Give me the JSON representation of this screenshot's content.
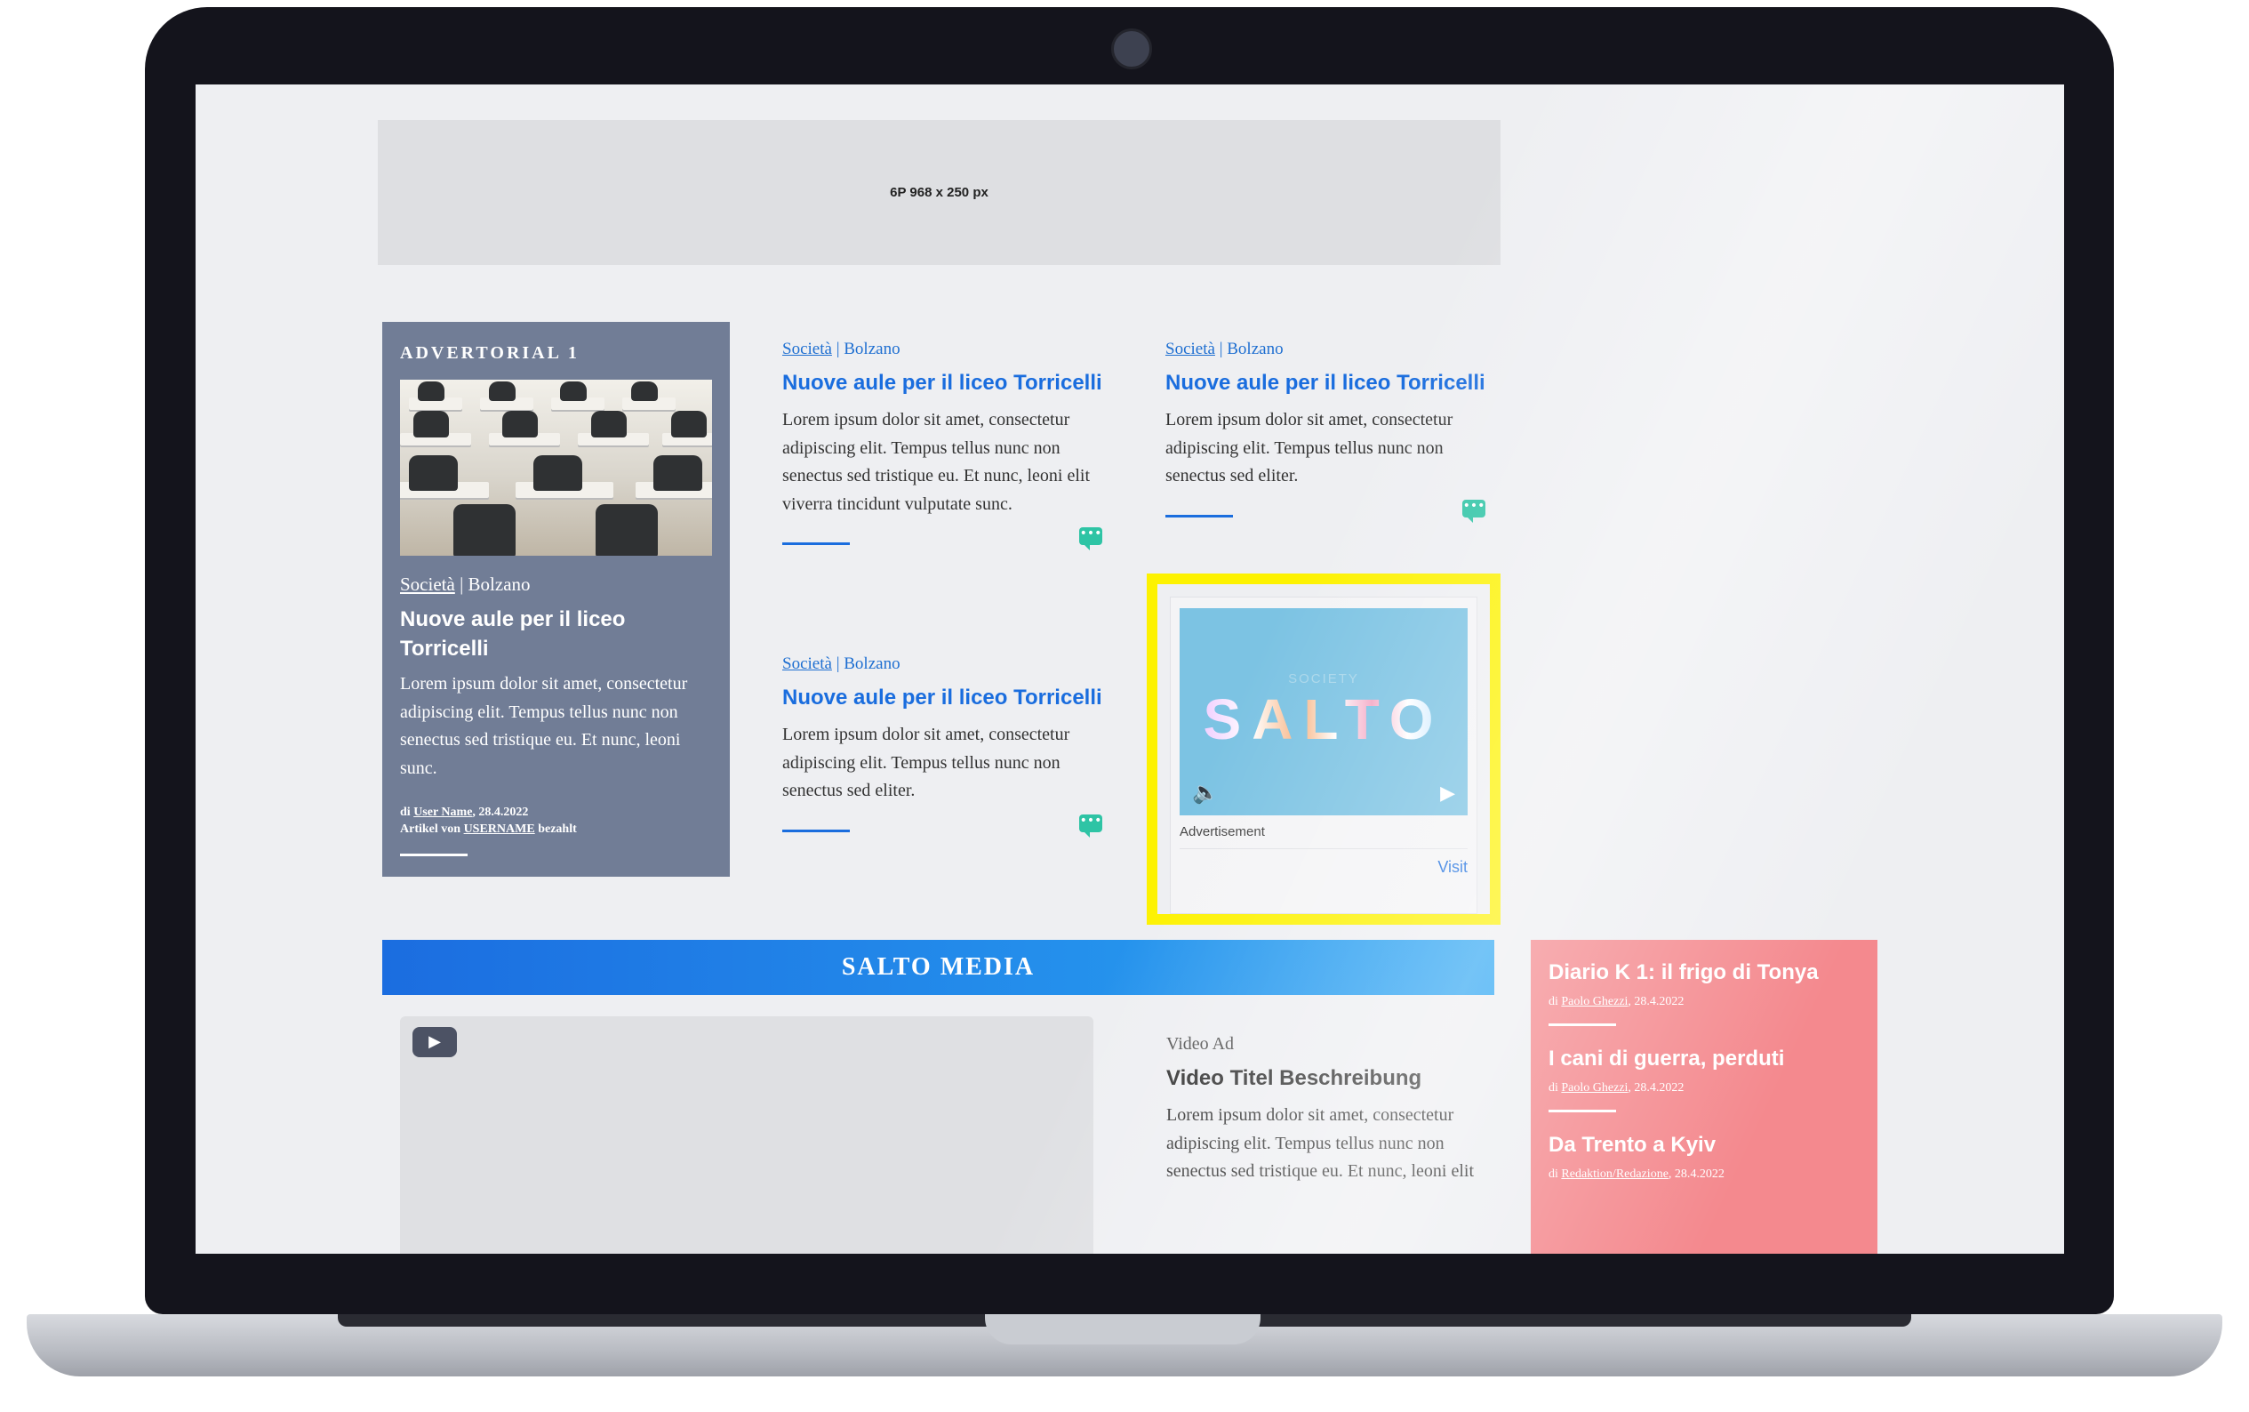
{
  "banner": {
    "label": "6P 968 x 250 px"
  },
  "advertorial": {
    "label": "ADVERTORIAL 1",
    "category": "Società",
    "location": "Bolzano",
    "headline": "Nuove aule per il liceo Torricelli",
    "text": "Lorem ipsum dolor sit amet, consectetur adipiscing elit. Tempus tellus nunc non senectus sed tristique eu. Et nunc, leoni sunc.",
    "byline_prefix": "di",
    "byline_user": "User Name",
    "byline_date": ", 28.4.2022",
    "paid_prefix": "Artikel von",
    "paid_user": "USERNAME",
    "paid_suffix": "bezahlt"
  },
  "teasers": [
    {
      "category": "Società",
      "location": "Bolzano",
      "headline": "Nuove aule per il liceo Torricelli",
      "text": "Lorem ipsum dolor sit amet, consectetur adipiscing elit. Tempus tellus nunc non senectus sed tristique eu. Et nunc, leoni elit viverra tincidunt vulputate sunc."
    },
    {
      "category": "Società",
      "location": "Bolzano",
      "headline": "Nuove aule per il liceo Torricelli",
      "text": "Lorem ipsum dolor sit amet, consectetur adipiscing elit. Tempus tellus nunc non senectus sed eliter."
    },
    {
      "category": "Società",
      "location": "Bolzano",
      "headline": "Nuove aule per il liceo Torricelli",
      "text": "Lorem ipsum dolor sit amet, consectetur adipiscing elit. Tempus tellus nunc non senectus sed eliter."
    }
  ],
  "ad": {
    "kicker": "SOCIETY",
    "logo": "SALTO",
    "label": "Advertisement",
    "visit": "Visit"
  },
  "media": {
    "title": "SALTO MEDIA",
    "kicker": "Video Ad",
    "headline": "Video Titel Beschreibung",
    "text": "Lorem ipsum dolor sit amet, consectetur adipiscing elit. Tempus tellus nunc non senectus sed tristique eu. Et nunc, leoni elit"
  },
  "sidebar": [
    {
      "title": "Diario K 1: il frigo di Tonya",
      "prefix": "di",
      "author": "Paolo Ghezzi",
      "date": ", 28.4.2022"
    },
    {
      "title": "I cani di guerra, perduti",
      "prefix": "di",
      "author": "Paolo Ghezzi",
      "date": ", 28.4.2022"
    },
    {
      "title": "Da Trento a Kyiv",
      "prefix": "di",
      "author": "Redaktion/Redazione",
      "date": ", 28.4.2022"
    }
  ],
  "colors": {
    "accent_blue": "#1a6dde",
    "highlight_yellow": "#fdf200",
    "pink": "#f4898e",
    "advertorial_bg": "#717d96"
  }
}
